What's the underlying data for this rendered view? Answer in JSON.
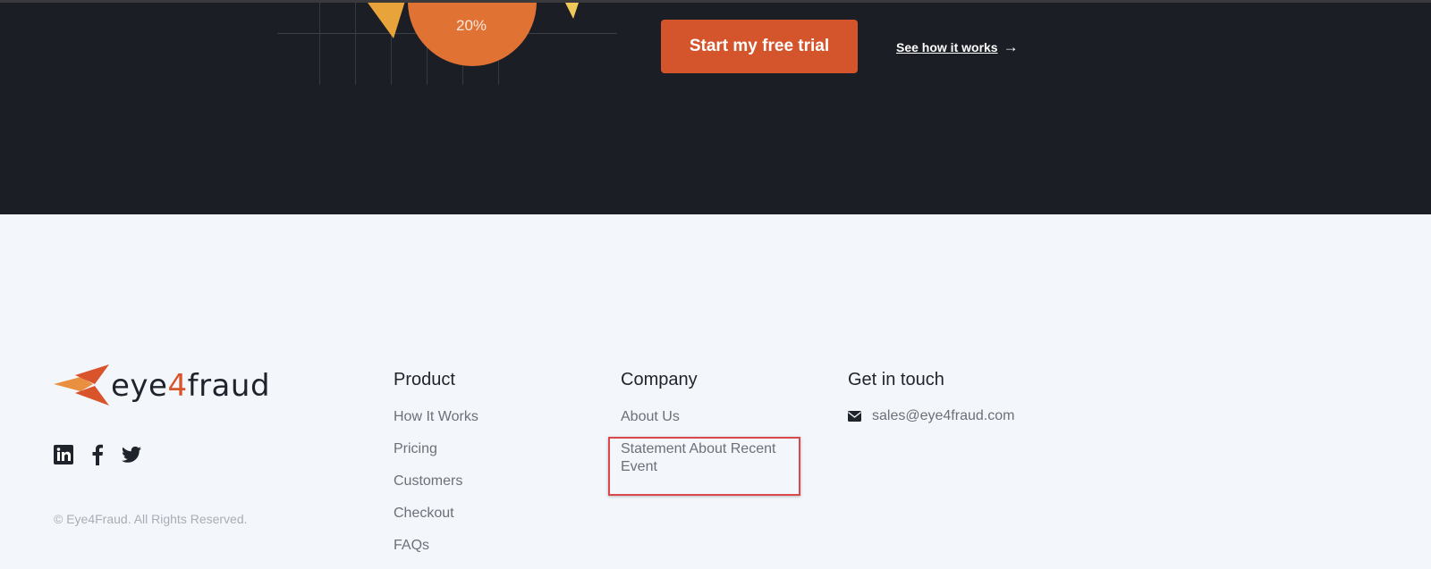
{
  "hero": {
    "chart_label": "20%",
    "cta_button": "Start my free trial",
    "secondary_link": "See how it works",
    "secondary_arrow": "→"
  },
  "footer": {
    "logo": {
      "prefix": "eye",
      "accent": "4",
      "suffix": "fraud"
    },
    "social": [
      "linkedin-icon",
      "facebook-icon",
      "twitter-icon"
    ],
    "copyright": "© Eye4Fraud. All Rights Reserved.",
    "columns": {
      "product": {
        "title": "Product",
        "links": [
          "How It Works",
          "Pricing",
          "Customers",
          "Checkout",
          "FAQs"
        ]
      },
      "company": {
        "title": "Company",
        "links": [
          "About Us",
          "Statement About Recent Event"
        ]
      },
      "contact": {
        "title": "Get in touch",
        "email": "sales@eye4fraud.com"
      }
    }
  },
  "colors": {
    "hero_bg": "#1b1e25",
    "accent": "#d4542b",
    "footer_bg": "#f3f6fa",
    "highlight": "#d9484a"
  }
}
